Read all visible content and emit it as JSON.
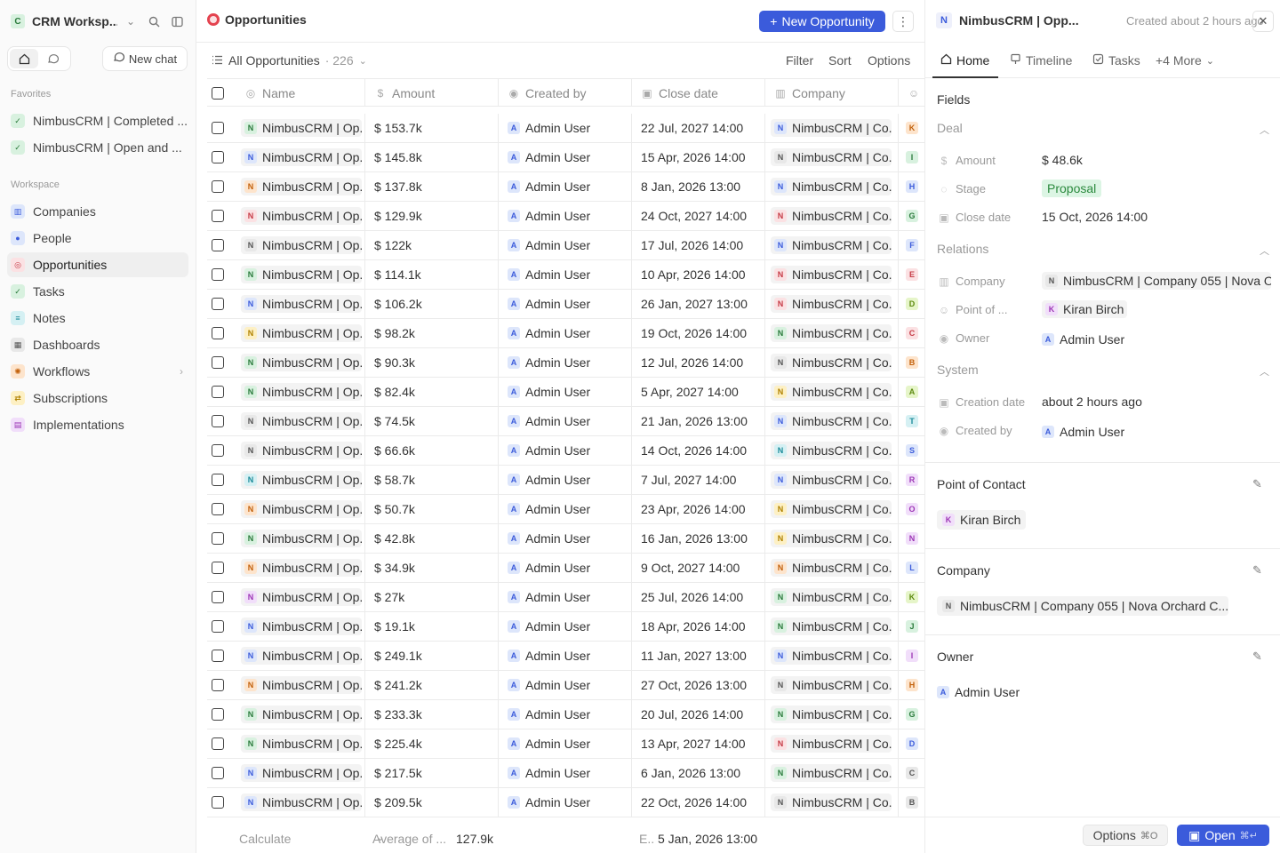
{
  "sidebar": {
    "workspace_badge": "C",
    "workspace_name": "CRM Worksp...",
    "new_chat": "New chat",
    "favorites_label": "Favorites",
    "favorites": [
      {
        "label": "NimbusCRM | Completed ..."
      },
      {
        "label": "NimbusCRM | Open and ..."
      }
    ],
    "workspace_label": "Workspace",
    "items": [
      {
        "label": "Companies"
      },
      {
        "label": "People"
      },
      {
        "label": "Opportunities"
      },
      {
        "label": "Tasks"
      },
      {
        "label": "Notes"
      },
      {
        "label": "Dashboards"
      },
      {
        "label": "Workflows"
      },
      {
        "label": "Subscriptions"
      },
      {
        "label": "Implementations"
      }
    ]
  },
  "main": {
    "title": "Opportunities",
    "new_button": "New Opportunity",
    "view_name": "All Opportunities",
    "view_count": "· 226",
    "actions": {
      "filter": "Filter",
      "sort": "Sort",
      "options": "Options"
    },
    "columns": {
      "name": "Name",
      "amount": "Amount",
      "created_by": "Created by",
      "close_date": "Close date",
      "company": "Company"
    },
    "rows": [
      {
        "badge": "N",
        "bc": "b-green",
        "name": "NimbusCRM | Op...",
        "amount": "$ 153.7k",
        "creator": "Admin User",
        "date": "22 Jul, 2027 14:00",
        "cbadge": "N",
        "cbc": "b-blue",
        "company": "NimbusCRM | Co...",
        "pbadge": "K",
        "pbc": "b-orange"
      },
      {
        "badge": "N",
        "bc": "b-blue",
        "name": "NimbusCRM | Op...",
        "amount": "$ 145.8k",
        "creator": "Admin User",
        "date": "15 Apr, 2026 14:00",
        "cbadge": "N",
        "cbc": "b-grey",
        "company": "NimbusCRM | Co...",
        "pbadge": "I",
        "pbc": "b-green"
      },
      {
        "badge": "N",
        "bc": "b-orange",
        "name": "NimbusCRM | Op...",
        "amount": "$ 137.8k",
        "creator": "Admin User",
        "date": "8 Jan, 2026 13:00",
        "cbadge": "N",
        "cbc": "b-blue",
        "company": "NimbusCRM | Co...",
        "pbadge": "H",
        "pbc": "b-blue"
      },
      {
        "badge": "N",
        "bc": "b-red",
        "name": "NimbusCRM | Op...",
        "amount": "$ 129.9k",
        "creator": "Admin User",
        "date": "24 Oct, 2027 14:00",
        "cbadge": "N",
        "cbc": "b-red",
        "company": "NimbusCRM | Co...",
        "pbadge": "G",
        "pbc": "b-green"
      },
      {
        "badge": "N",
        "bc": "b-grey",
        "name": "NimbusCRM | Op...",
        "amount": "$ 122k",
        "creator": "Admin User",
        "date": "17 Jul, 2026 14:00",
        "cbadge": "N",
        "cbc": "b-blue",
        "company": "NimbusCRM | Co...",
        "pbadge": "F",
        "pbc": "b-blue"
      },
      {
        "badge": "N",
        "bc": "b-green",
        "name": "NimbusCRM | Op...",
        "amount": "$ 114.1k",
        "creator": "Admin User",
        "date": "10 Apr, 2026 14:00",
        "cbadge": "N",
        "cbc": "b-red",
        "company": "NimbusCRM | Co...",
        "pbadge": "E",
        "pbc": "b-red"
      },
      {
        "badge": "N",
        "bc": "b-blue",
        "name": "NimbusCRM | Op...",
        "amount": "$ 106.2k",
        "creator": "Admin User",
        "date": "26 Jan, 2027 13:00",
        "cbadge": "N",
        "cbc": "b-red",
        "company": "NimbusCRM | Co...",
        "pbadge": "D",
        "pbc": "b-lime"
      },
      {
        "badge": "N",
        "bc": "b-yellow",
        "name": "NimbusCRM | Op...",
        "amount": "$ 98.2k",
        "creator": "Admin User",
        "date": "19 Oct, 2026 14:00",
        "cbadge": "N",
        "cbc": "b-green",
        "company": "NimbusCRM | Co...",
        "pbadge": "C",
        "pbc": "b-red"
      },
      {
        "badge": "N",
        "bc": "b-green",
        "name": "NimbusCRM | Op...",
        "amount": "$ 90.3k",
        "creator": "Admin User",
        "date": "12 Jul, 2026 14:00",
        "cbadge": "N",
        "cbc": "b-grey",
        "company": "NimbusCRM | Co...",
        "pbadge": "B",
        "pbc": "b-orange"
      },
      {
        "badge": "N",
        "bc": "b-green",
        "name": "NimbusCRM | Op...",
        "amount": "$ 82.4k",
        "creator": "Admin User",
        "date": "5 Apr, 2027 14:00",
        "cbadge": "N",
        "cbc": "b-yellow",
        "company": "NimbusCRM | Co...",
        "pbadge": "A",
        "pbc": "b-lime"
      },
      {
        "badge": "N",
        "bc": "b-grey",
        "name": "NimbusCRM | Op...",
        "amount": "$ 74.5k",
        "creator": "Admin User",
        "date": "21 Jan, 2026 13:00",
        "cbadge": "N",
        "cbc": "b-blue",
        "company": "NimbusCRM | Co...",
        "pbadge": "T",
        "pbc": "b-teal"
      },
      {
        "badge": "N",
        "bc": "b-grey",
        "name": "NimbusCRM | Op...",
        "amount": "$ 66.6k",
        "creator": "Admin User",
        "date": "14 Oct, 2026 14:00",
        "cbadge": "N",
        "cbc": "b-teal",
        "company": "NimbusCRM | Co...",
        "pbadge": "S",
        "pbc": "b-blue"
      },
      {
        "badge": "N",
        "bc": "b-teal",
        "name": "NimbusCRM | Op...",
        "amount": "$ 58.7k",
        "creator": "Admin User",
        "date": "7 Jul, 2027 14:00",
        "cbadge": "N",
        "cbc": "b-blue",
        "company": "NimbusCRM | Co...",
        "pbadge": "R",
        "pbc": "b-purple"
      },
      {
        "badge": "N",
        "bc": "b-orange",
        "name": "NimbusCRM | Op...",
        "amount": "$ 50.7k",
        "creator": "Admin User",
        "date": "23 Apr, 2026 14:00",
        "cbadge": "N",
        "cbc": "b-yellow",
        "company": "NimbusCRM | Co...",
        "pbadge": "O",
        "pbc": "b-purple"
      },
      {
        "badge": "N",
        "bc": "b-green",
        "name": "NimbusCRM | Op...",
        "amount": "$ 42.8k",
        "creator": "Admin User",
        "date": "16 Jan, 2026 13:00",
        "cbadge": "N",
        "cbc": "b-yellow",
        "company": "NimbusCRM | Co...",
        "pbadge": "N",
        "pbc": "b-purple"
      },
      {
        "badge": "N",
        "bc": "b-orange",
        "name": "NimbusCRM | Op...",
        "amount": "$ 34.9k",
        "creator": "Admin User",
        "date": "9 Oct, 2027 14:00",
        "cbadge": "N",
        "cbc": "b-orange",
        "company": "NimbusCRM | Co...",
        "pbadge": "L",
        "pbc": "b-blue"
      },
      {
        "badge": "N",
        "bc": "b-purple",
        "name": "NimbusCRM | Op...",
        "amount": "$ 27k",
        "creator": "Admin User",
        "date": "25 Jul, 2026 14:00",
        "cbadge": "N",
        "cbc": "b-green",
        "company": "NimbusCRM | Co...",
        "pbadge": "K",
        "pbc": "b-lime"
      },
      {
        "badge": "N",
        "bc": "b-blue",
        "name": "NimbusCRM | Op...",
        "amount": "$ 19.1k",
        "creator": "Admin User",
        "date": "18 Apr, 2026 14:00",
        "cbadge": "N",
        "cbc": "b-green",
        "company": "NimbusCRM | Co...",
        "pbadge": "J",
        "pbc": "b-green"
      },
      {
        "badge": "N",
        "bc": "b-blue",
        "name": "NimbusCRM | Op...",
        "amount": "$ 249.1k",
        "creator": "Admin User",
        "date": "11 Jan, 2027 13:00",
        "cbadge": "N",
        "cbc": "b-blue",
        "company": "NimbusCRM | Co...",
        "pbadge": "I",
        "pbc": "b-purple"
      },
      {
        "badge": "N",
        "bc": "b-orange",
        "name": "NimbusCRM | Op...",
        "amount": "$ 241.2k",
        "creator": "Admin User",
        "date": "27 Oct, 2026 13:00",
        "cbadge": "N",
        "cbc": "b-grey",
        "company": "NimbusCRM | Co...",
        "pbadge": "H",
        "pbc": "b-orange"
      },
      {
        "badge": "N",
        "bc": "b-green",
        "name": "NimbusCRM | Op...",
        "amount": "$ 233.3k",
        "creator": "Admin User",
        "date": "20 Jul, 2026 14:00",
        "cbadge": "N",
        "cbc": "b-green",
        "company": "NimbusCRM | Co...",
        "pbadge": "G",
        "pbc": "b-green"
      },
      {
        "badge": "N",
        "bc": "b-green",
        "name": "NimbusCRM | Op...",
        "amount": "$ 225.4k",
        "creator": "Admin User",
        "date": "13 Apr, 2027 14:00",
        "cbadge": "N",
        "cbc": "b-red",
        "company": "NimbusCRM | Co...",
        "pbadge": "D",
        "pbc": "b-blue"
      },
      {
        "badge": "N",
        "bc": "b-blue",
        "name": "NimbusCRM | Op...",
        "amount": "$ 217.5k",
        "creator": "Admin User",
        "date": "6 Jan, 2026 13:00",
        "cbadge": "N",
        "cbc": "b-green",
        "company": "NimbusCRM | Co...",
        "pbadge": "C",
        "pbc": "b-grey"
      },
      {
        "badge": "N",
        "bc": "b-blue",
        "name": "NimbusCRM | Op...",
        "amount": "$ 209.5k",
        "creator": "Admin User",
        "date": "22 Oct, 2026 14:00",
        "cbadge": "N",
        "cbc": "b-grey",
        "company": "NimbusCRM | Co...",
        "pbadge": "B",
        "pbc": "b-grey"
      }
    ],
    "footer": {
      "calculate": "Calculate",
      "avg_label": "Average of ...",
      "avg_value": "127.9k",
      "date_label": "E..",
      "date_value": "5 Jan, 2026 13:00"
    }
  },
  "panel": {
    "badge": "N",
    "title": "NimbusCRM | Opp...",
    "subtitle": "Created about 2 hours ago",
    "tabs": {
      "home": "Home",
      "timeline": "Timeline",
      "tasks": "Tasks",
      "more": "+4 More"
    },
    "fields_title": "Fields",
    "deal_label": "Deal",
    "amount_label": "Amount",
    "amount_value": "$ 48.6k",
    "stage_label": "Stage",
    "stage_value": "Proposal",
    "close_label": "Close date",
    "close_value": "15 Oct, 2026 14:00",
    "relations_label": "Relations",
    "company_label": "Company",
    "company_value": "NimbusCRM | Company 055 | Nova O",
    "poc_label": "Point of ...",
    "poc_value": "Kiran Birch",
    "owner_label": "Owner",
    "owner_value": "Admin User",
    "system_label": "System",
    "creation_label": "Creation date",
    "creation_value": "about 2 hours ago",
    "createdby_label": "Created by",
    "createdby_value": "Admin User",
    "poc_card_title": "Point of Contact",
    "poc_card_value": "Kiran Birch",
    "company_card_title": "Company",
    "company_card_value": "NimbusCRM | Company 055 | Nova Orchard C...",
    "owner_card_title": "Owner",
    "owner_card_value": "Admin User",
    "options_btn": "Options",
    "options_kbd": "⌘O",
    "open_btn": "Open",
    "open_kbd": "⌘↵"
  },
  "colors": {
    "accent": "#3b5bdb",
    "stage_bg": "#dcf5e4",
    "stage_fg": "#2b8a3e",
    "title_icon": "#e4434f"
  }
}
